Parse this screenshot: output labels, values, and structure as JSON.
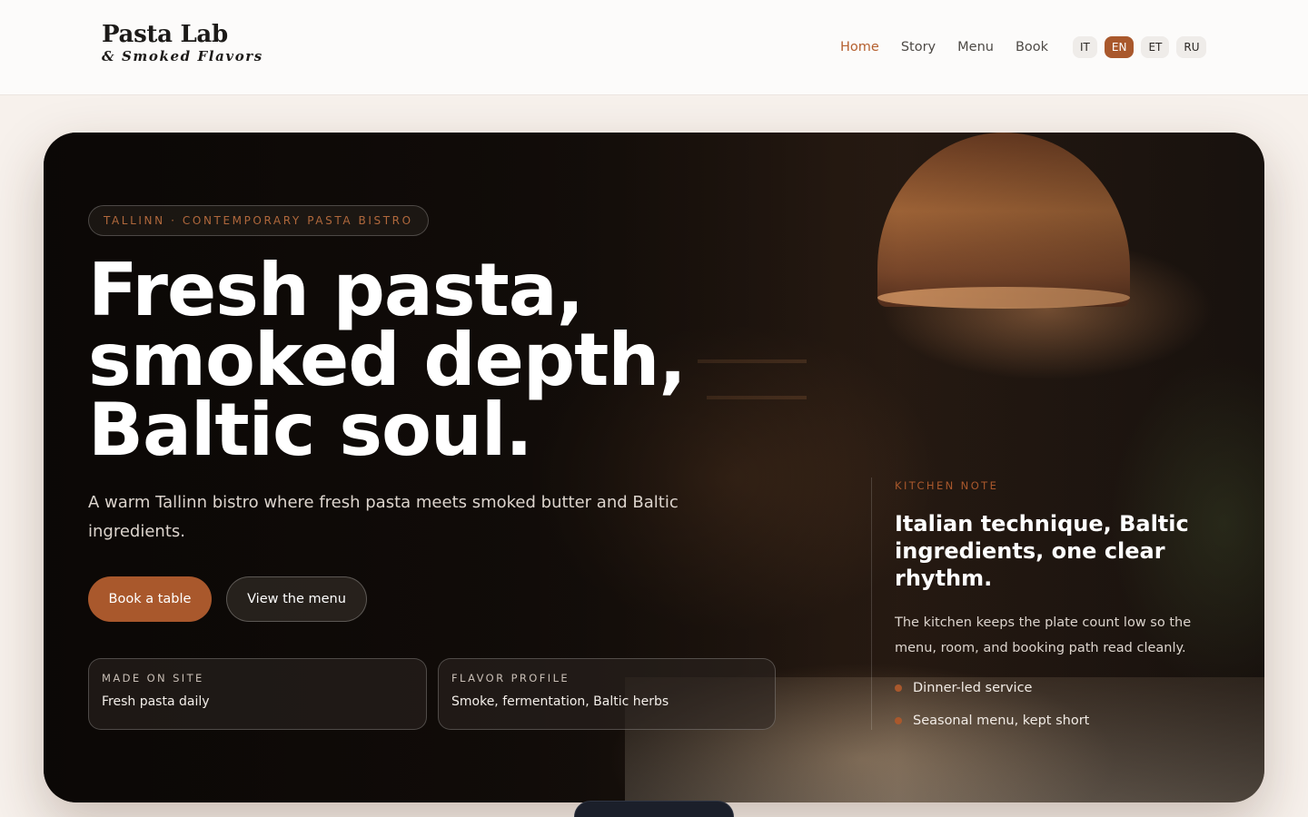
{
  "brand": {
    "name": "Pasta Lab",
    "tagline": "& Smoked Flavors"
  },
  "nav": {
    "items": [
      {
        "label": "Home",
        "active": true
      },
      {
        "label": "Story",
        "active": false
      },
      {
        "label": "Menu",
        "active": false
      },
      {
        "label": "Book",
        "active": false
      }
    ]
  },
  "languages": [
    {
      "label": "IT",
      "active": false
    },
    {
      "label": "EN",
      "active": true
    },
    {
      "label": "ET",
      "active": false
    },
    {
      "label": "RU",
      "active": false
    }
  ],
  "hero": {
    "eyebrow": "TALLINN · CONTEMPORARY PASTA BISTRO",
    "headline": [
      "Fresh pasta,",
      "smoked depth,",
      "Baltic soul."
    ],
    "lede": "A warm Tallinn bistro where fresh pasta meets smoked butter and Baltic ingredients.",
    "primary_cta": "Book a table",
    "secondary_cta": "View the menu",
    "cards": [
      {
        "label": "MADE ON SITE",
        "value": "Fresh pasta daily"
      },
      {
        "label": "FLAVOR PROFILE",
        "value": "Smoke, fermentation, Baltic herbs"
      }
    ]
  },
  "kitchen_note": {
    "label": "KITCHEN NOTE",
    "title": "Italian technique, Baltic ingredients, one clear rhythm.",
    "body": "The kitchen keeps the plate count low so the menu, room, and booking path read cleanly.",
    "points": [
      "Dinner-led service",
      "Seasonal menu, kept short"
    ]
  },
  "colors": {
    "accent": "#a9582c",
    "accent_text": "#b5602f",
    "page_bg": "#f7f1ec",
    "header_bg": "#fcfbfa"
  }
}
